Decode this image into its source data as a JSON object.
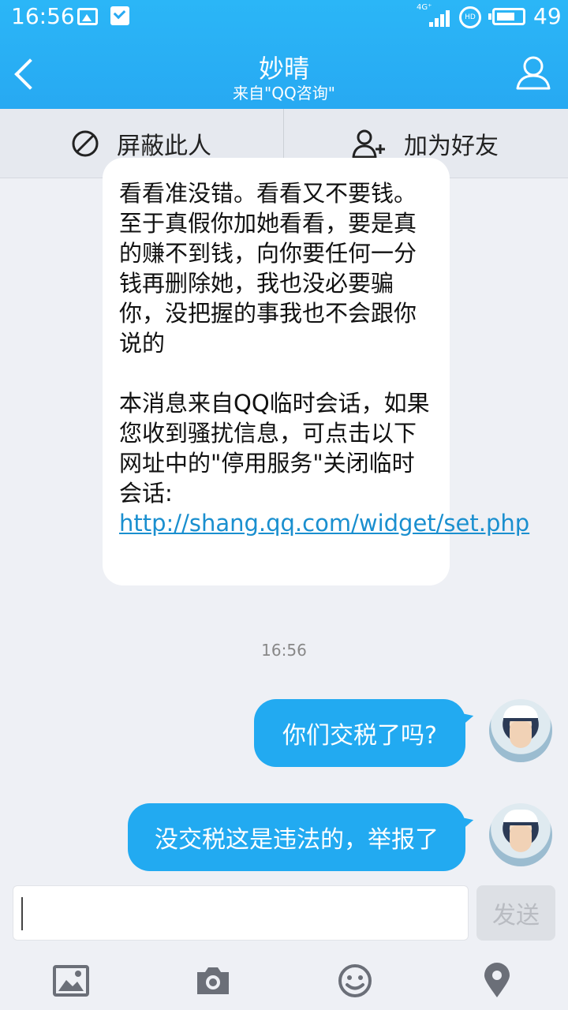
{
  "status_bar": {
    "time": "16:56",
    "network": "4G⁺",
    "hd_label": "HD",
    "battery": "49"
  },
  "header": {
    "title": "妙晴",
    "subtitle": "来自\"QQ咨询\""
  },
  "actions": {
    "block_label": "屏蔽此人",
    "add_friend_label": "加为好友"
  },
  "incoming_message": {
    "text": "看看准没错。看看又不要钱。至于真假你加她看看，要是真的赚不到钱，向你要任何一分钱再删除她，我也没必要骗你，没把握的事我也不会跟你说的\n\n本消息来自QQ临时会话，如果您收到骚扰信息，可点击以下网址中的\"停用服务\"关闭临时会话: ",
    "link": "http://shang.qq.com/widget/set.php"
  },
  "timestamp": "16:56",
  "outgoing_messages": [
    {
      "text": "你们交税了吗?"
    },
    {
      "text": "没交税这是违法的，举报了"
    }
  ],
  "composer": {
    "placeholder": "",
    "send_label": "发送"
  },
  "toolbar": {
    "icons": [
      "image-icon",
      "camera-icon",
      "emoji-icon",
      "location-icon"
    ]
  },
  "colors": {
    "header_blue": "#27a9f2",
    "bubble_blue": "#22aaf1",
    "link_blue": "#1a8fcf",
    "background": "#eef0f5"
  }
}
